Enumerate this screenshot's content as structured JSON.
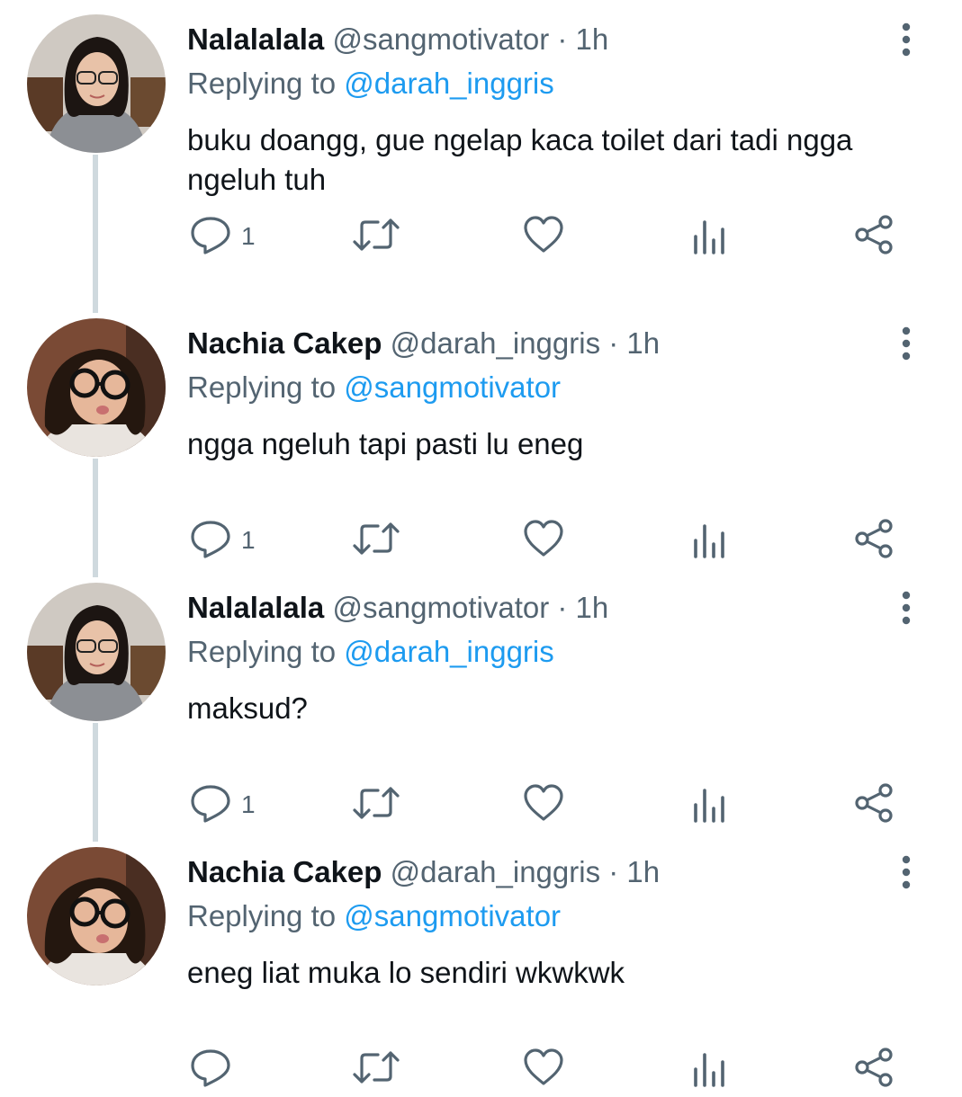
{
  "tweets": [
    {
      "name": "Nalalalala",
      "handle": "@sangmotivator",
      "time": "· 1h",
      "replying_prefix": "Replying to",
      "replying_to": "@darah_inggris",
      "text": "buku doangg, gue ngelap kaca toilet dari tadi ngga ngeluh tuh",
      "reply_count": "1"
    },
    {
      "name": "Nachia Cakep",
      "handle": "@darah_inggris",
      "time": "· 1h",
      "replying_prefix": "Replying to",
      "replying_to": "@sangmotivator",
      "text": "ngga ngeluh tapi pasti lu eneg",
      "reply_count": "1"
    },
    {
      "name": "Nalalalala",
      "handle": "@sangmotivator",
      "time": "· 1h",
      "replying_prefix": "Replying to",
      "replying_to": "@darah_inggris",
      "text": "maksud?",
      "reply_count": "1"
    },
    {
      "name": "Nachia Cakep",
      "handle": "@darah_inggris",
      "time": "· 1h",
      "replying_prefix": "Replying to",
      "replying_to": "@sangmotivator",
      "text": "eneg liat muka lo sendiri wkwkwk",
      "reply_count": ""
    }
  ],
  "colors": {
    "text": "#0f1419",
    "secondary": "#536471",
    "mention": "#1d9bf0",
    "thread_line": "#cfd9de"
  },
  "icons": [
    "more-vertical-icon",
    "reply-icon",
    "retweet-icon",
    "like-icon",
    "views-icon",
    "share-icon"
  ]
}
